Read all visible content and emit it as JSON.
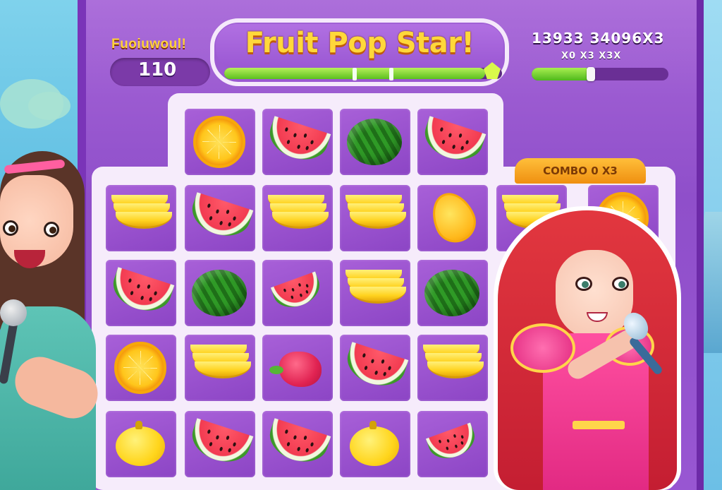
{
  "game": {
    "title": "Fruit Pop Star!",
    "score_label": "Fuoiuwoul!",
    "score_value": "110",
    "stat_top": "13933 34096X3",
    "stat_sub": "X0 X3 X3X",
    "combo_label": "COMBO 0 X3",
    "main_progress": 0.94,
    "side_progress": 0.44
  },
  "board": {
    "rows": [
      [
        "",
        "orange",
        "melon-slice",
        "melon-whole",
        "melon-slice",
        "",
        ""
      ],
      [
        "banana",
        "melon-slice",
        "banana",
        "banana",
        "orange-half",
        "banana",
        "orange"
      ],
      [
        "melon-slice",
        "melon-whole",
        "melon-splash",
        "banana",
        "melon-whole",
        "",
        ""
      ],
      [
        "orange",
        "banana",
        "berry",
        "melon-slice",
        "banana",
        "",
        ""
      ],
      [
        "lemon",
        "melon-slice",
        "melon-slice",
        "lemon",
        "melon-splash",
        "",
        ""
      ]
    ]
  },
  "colors": {
    "panel": "#9856d2",
    "title_text": "#ffd83a",
    "progress_green": "#5cbf1e",
    "combo_bg": "#ef8f10"
  },
  "icons": [
    "orange-icon",
    "watermelon-slice-icon",
    "watermelon-icon",
    "banana-icon",
    "lemon-icon",
    "berry-icon"
  ]
}
